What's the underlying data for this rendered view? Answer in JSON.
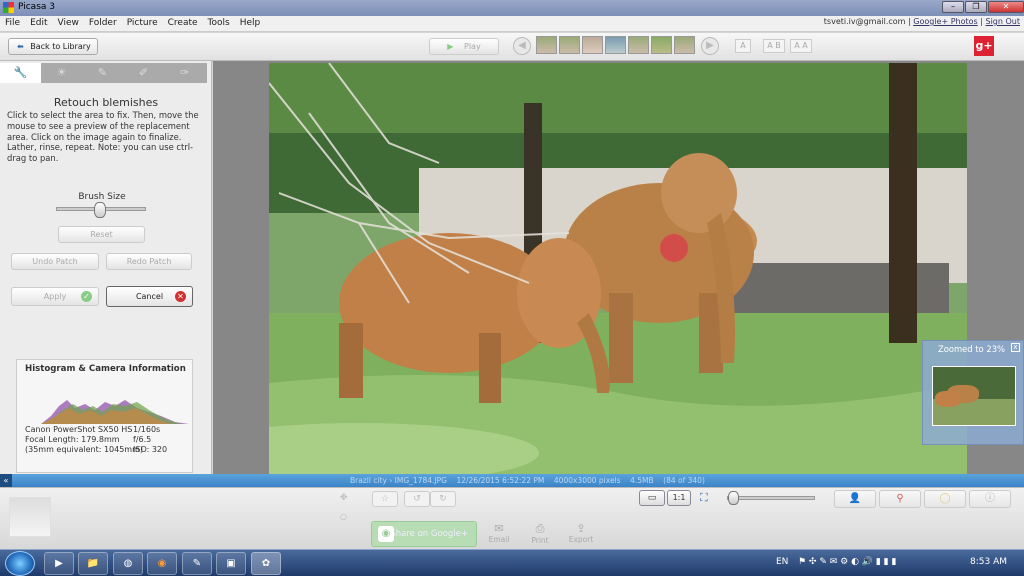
{
  "window": {
    "title": "Picasa 3",
    "min": "–",
    "max": "❐",
    "close": "✕"
  },
  "menu": [
    "File",
    "Edit",
    "View",
    "Folder",
    "Picture",
    "Create",
    "Tools",
    "Help"
  ],
  "account": {
    "email": "tsveti.iv@gmail.com",
    "sep": "|",
    "photos": "Google+ Photos",
    "signout": "Sign Out"
  },
  "toolbar": {
    "back": "Back to Library",
    "play": "Play",
    "prev": "◀",
    "next": "▶",
    "caption_a": "A",
    "caption_ab": "A B",
    "caption_aa": "A A",
    "gplus": "g+"
  },
  "panel": {
    "tab_icons": [
      "wrench-icon",
      "sun-icon",
      "brush-icon",
      "brush2-icon",
      "brush3-icon"
    ],
    "tool_title": "Retouch blemishes",
    "tool_desc": "Click to select the area to fix. Then, move the mouse to see a preview of the replacement area.  Click on the image again to finalize. Lather, rinse, repeat.  Note:  you can use ctrl-drag to pan.",
    "brush_label": "Brush Size",
    "reset": "Reset",
    "undo": "Undo Patch",
    "redo": "Redo Patch",
    "apply": "Apply",
    "cancel": "Cancel",
    "hist_title": "Histogram & Camera Information",
    "camera": "Canon PowerShot SX50 HS",
    "shutter": "1/160s",
    "focal": "Focal Length: 179.8mm",
    "fstop": "f/6.5",
    "equiv": "(35mm equivalent: 1045mm)",
    "iso": "ISO: 320"
  },
  "viewer": {
    "zoom_label": "Zoomed to",
    "zoom_value": "23%",
    "zoom_close": "x"
  },
  "status": {
    "text": "Brazil city › IMG_1784.JPG    12/26/2015 6:52:22 PM    4000x3000 pixels    4.5MB    (84 of 340)"
  },
  "tray": {
    "share": "Share on Google+",
    "email": "Email",
    "print": "Print",
    "export": "Export",
    "fit": "1:1"
  },
  "taskbar": {
    "lang": "EN",
    "time": "8:53 AM"
  },
  "colors": {
    "accent": "#3b83c6",
    "cancel": "#d0302f",
    "apply_check": "#5cbf4c"
  }
}
